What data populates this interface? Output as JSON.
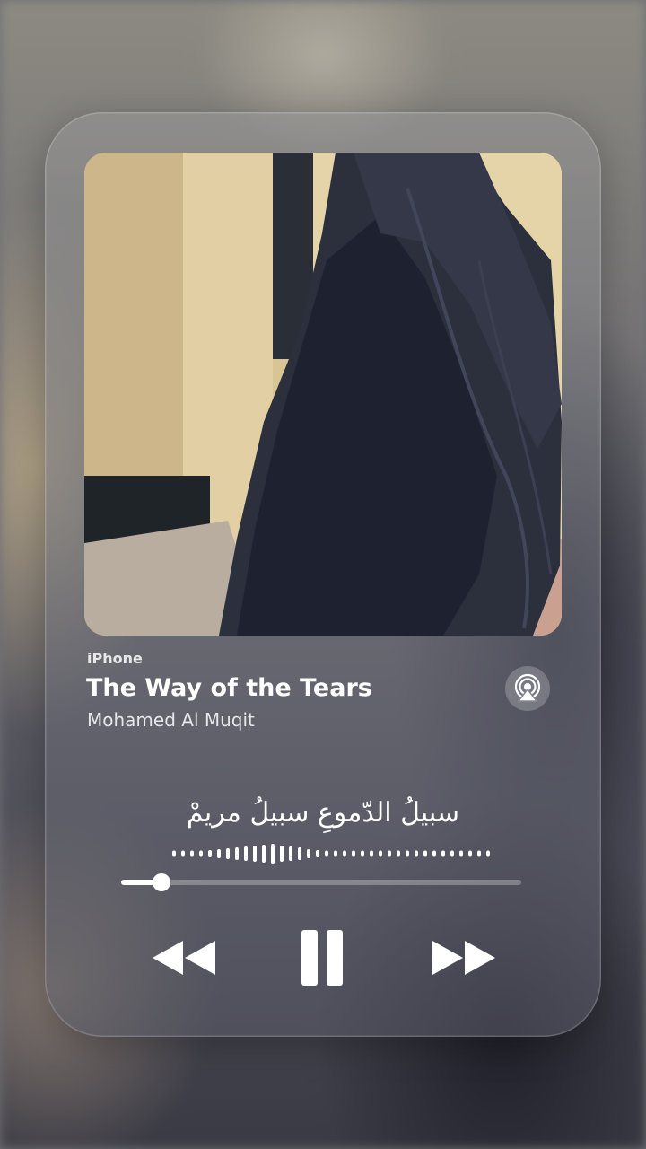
{
  "now_playing": {
    "device_label": "iPhone",
    "track_title": "The Way of the Tears",
    "artist": "Mohamed Al Muqit",
    "lyric_line": "سبيلُ الدّموعِ سبيلُ مريمْ"
  },
  "playback": {
    "progress": 0.1,
    "state": "playing"
  },
  "icons": {
    "airplay": "airplay-audio-icon",
    "rewind": "rewind-icon",
    "pause": "pause-icon",
    "forward": "fast-forward-icon"
  },
  "colors": {
    "accent": "#ffffff",
    "track": "#9a9aa2"
  }
}
